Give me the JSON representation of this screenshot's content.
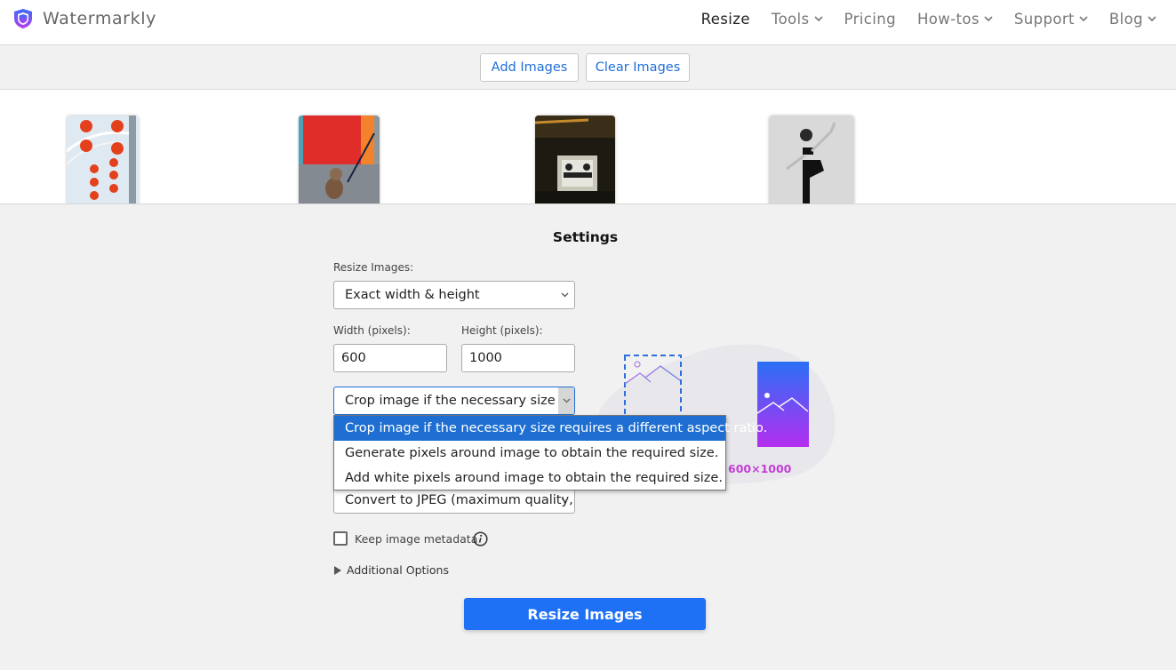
{
  "header": {
    "brand": "Watermarkly",
    "logo_icon": "shield-icon",
    "nav": [
      {
        "label": "Resize",
        "active": true,
        "has_dropdown": false
      },
      {
        "label": "Tools",
        "active": false,
        "has_dropdown": true
      },
      {
        "label": "Pricing",
        "active": false,
        "has_dropdown": false
      },
      {
        "label": "How-tos",
        "active": false,
        "has_dropdown": true
      },
      {
        "label": "Support",
        "active": false,
        "has_dropdown": true
      },
      {
        "label": "Blog",
        "active": false,
        "has_dropdown": true
      }
    ]
  },
  "toolbar": {
    "add_label": "Add Images",
    "clear_label": "Clear Images"
  },
  "thumbnails": [
    {
      "description": "red lanterns"
    },
    {
      "description": "dog on leash by red door"
    },
    {
      "description": "dark cafe interior"
    },
    {
      "description": "black and white dancer"
    }
  ],
  "settings": {
    "title": "Settings",
    "resize_label": "Resize Images:",
    "resize_value": "Exact width & height",
    "width_label": "Width (pixels):",
    "width_value": "600",
    "height_label": "Height (pixels):",
    "height_value": "1000",
    "fit_value": "Crop image if the necessary size rec",
    "fit_options": [
      {
        "label": "Crop image if the necessary size requires a different aspect ratio.",
        "selected": true
      },
      {
        "label": "Generate pixels around image to obtain the required size.",
        "selected": false
      },
      {
        "label": "Add white pixels around image to obtain the required size.",
        "selected": false
      }
    ],
    "format_value": "Convert to JPEG (maximum quality,",
    "metadata_label": "Keep image metadata",
    "metadata_checked": false,
    "additional_label": "Additional Options",
    "preview_size_label": "600×1000",
    "submit_label": "Resize Images"
  },
  "colors": {
    "accent": "#1e70f5",
    "link": "#1e6fd9",
    "dropdown_selected": "#1e6fd1",
    "size_label": "#c43fd6"
  }
}
